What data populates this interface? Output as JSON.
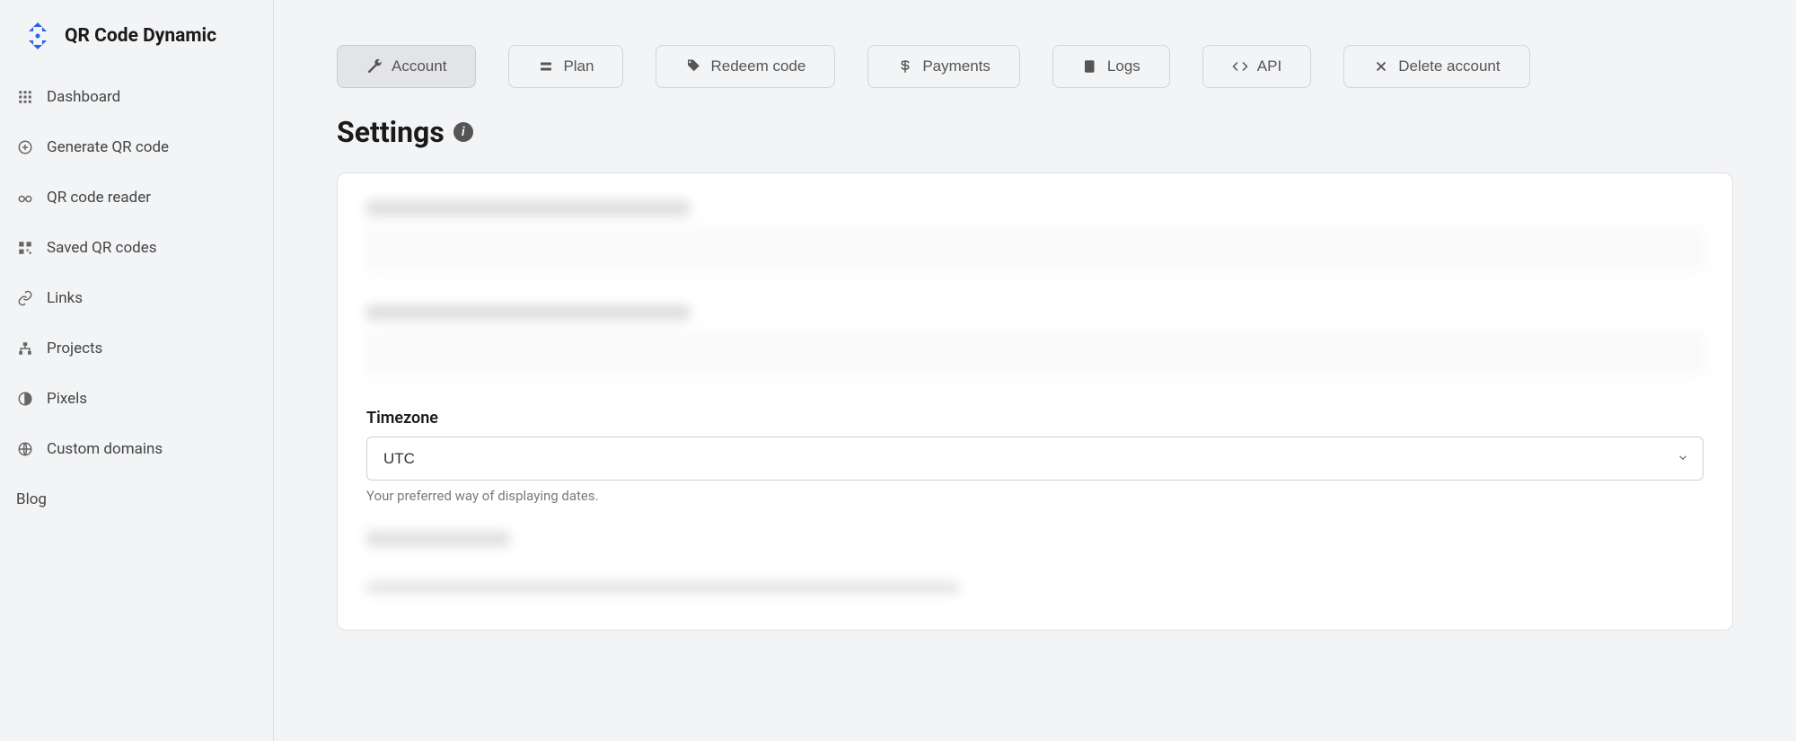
{
  "brand": {
    "name": "QR Code Dynamic"
  },
  "sidebar": {
    "items": [
      {
        "label": "Dashboard"
      },
      {
        "label": "Generate QR code"
      },
      {
        "label": "QR code reader"
      },
      {
        "label": "Saved QR codes"
      },
      {
        "label": "Links"
      },
      {
        "label": "Projects"
      },
      {
        "label": "Pixels"
      },
      {
        "label": "Custom domains"
      },
      {
        "label": "Blog"
      }
    ]
  },
  "tabs": {
    "account": "Account",
    "plan": "Plan",
    "redeem": "Redeem code",
    "payments": "Payments",
    "logs": "Logs",
    "api": "API",
    "delete": "Delete account"
  },
  "heading": {
    "title": "Settings"
  },
  "timezone": {
    "label": "Timezone",
    "value": "UTC",
    "help": "Your preferred way of displaying dates."
  }
}
